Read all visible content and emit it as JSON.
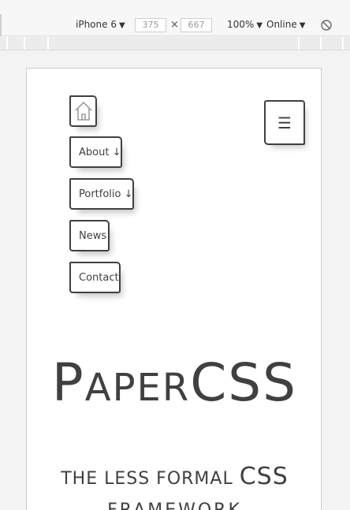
{
  "devtools": {
    "device": "iPhone 6",
    "width": "375",
    "height": "667",
    "dimension_separator": "×",
    "zoom": "100%",
    "throttle": "Online",
    "caret": "▼"
  },
  "nav": {
    "home_icon": "house-icon",
    "menu_icon": "hamburger-icon",
    "menu_glyph": "☰",
    "items": [
      {
        "label": "About ↓"
      },
      {
        "label": "Portfolio ↓"
      },
      {
        "label": "News"
      },
      {
        "label": "Contact"
      }
    ]
  },
  "hero": {
    "title_first": "P",
    "title_rest": "APER",
    "title_css": "CSS",
    "subtitle_prefix": "THE LESS FORMAL ",
    "subtitle_css": "CSS",
    "subtitle_line2": "FRAMEWORK"
  }
}
